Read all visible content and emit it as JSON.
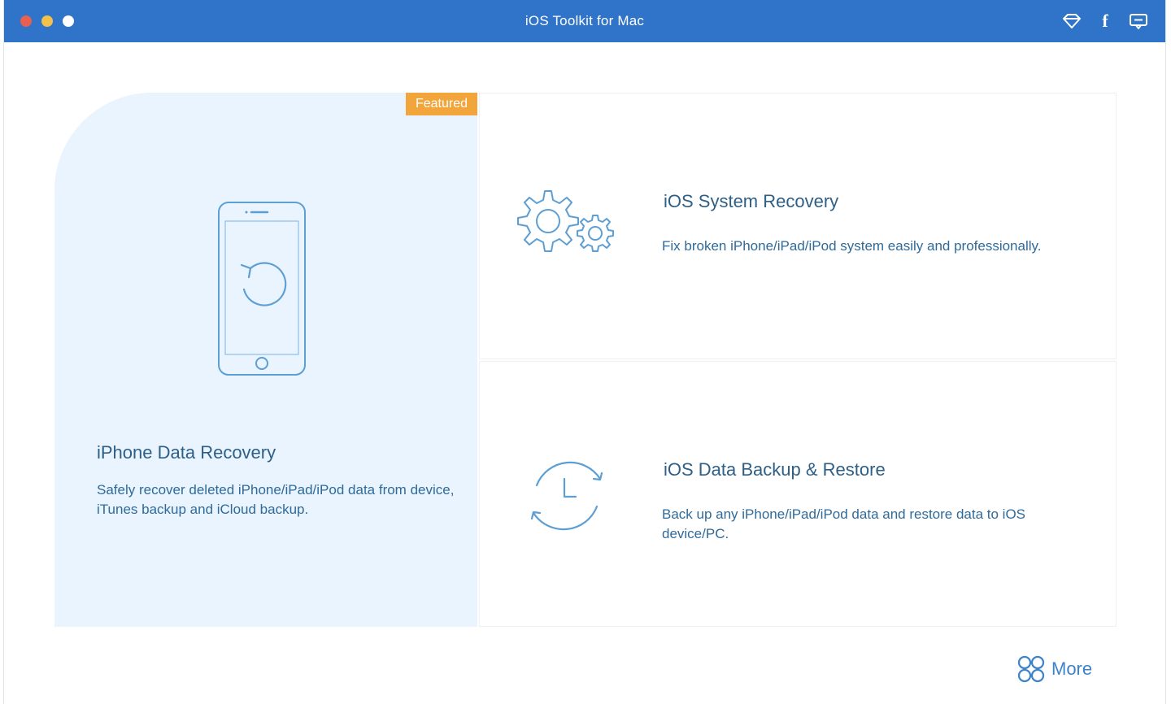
{
  "window": {
    "title": "iOS Toolkit for Mac"
  },
  "toolbar": {
    "facebook_glyph": "f"
  },
  "main_card": {
    "badge": "Featured",
    "title": "iPhone Data Recovery",
    "description": "Safely recover deleted iPhone/iPad/iPod data from device, iTunes backup and iCloud backup."
  },
  "system_card": {
    "title": "iOS System Recovery",
    "description": "Fix broken iPhone/iPad/iPod system easily and professionally."
  },
  "backup_card": {
    "title": "iOS Data Backup & Restore",
    "description": "Back up any iPhone/iPad/iPod data and restore data to iOS device/PC."
  },
  "footer": {
    "more_label": "More"
  },
  "icons": {
    "titlebar": [
      "diamond-icon",
      "facebook-icon",
      "feedback-icon"
    ],
    "cards": [
      "phone-recovery-icon",
      "gears-icon",
      "clock-sync-icon",
      "more-grid-icon"
    ]
  },
  "colors": {
    "titlebar": "#2f74c8",
    "featured_badge": "#f2a53a",
    "highlight_card": "#e9f4fe",
    "text_title": "#2e5f86",
    "text_desc": "#2f6a99",
    "accent": "#3c82c9"
  }
}
